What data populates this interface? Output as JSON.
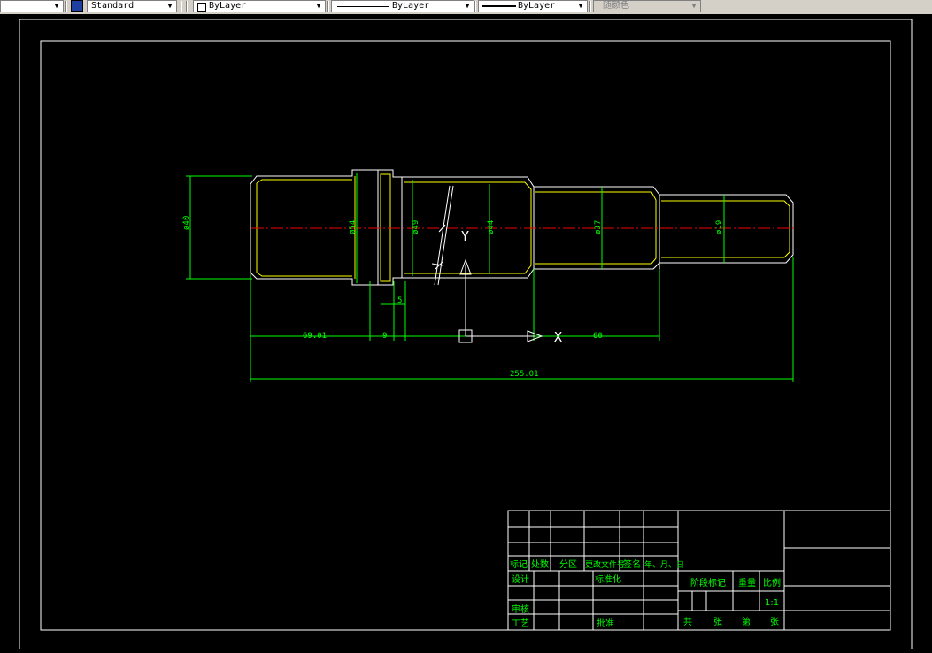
{
  "toolbar": {
    "textstyle": "Standard",
    "layer": "ByLayer",
    "linetype": "ByLayer",
    "lineweight": "ByLayer",
    "color": "随颜色"
  },
  "drawing": {
    "diameters": [
      "ø40",
      "ø54",
      "ø49",
      "ø44",
      "ø37",
      "ø19"
    ],
    "dims": [
      "5",
      "69.01",
      "9",
      "60",
      "255.01"
    ],
    "ucs": {
      "x": "X",
      "y": "Y"
    }
  },
  "title_block": {
    "revision_headers": [
      "标记",
      "处数",
      "分区",
      "更改文件号",
      "签名",
      "年、月、日"
    ],
    "design": "设计",
    "standardize": "标准化",
    "review": "审核",
    "process": "工艺",
    "approve": "批准",
    "stage_mark": "阶段标记",
    "weight": "重量",
    "scale_label": "比例",
    "scale_value": "1:1",
    "total": "共",
    "sheets": "张",
    "page": "第",
    "sheet_word": "张"
  }
}
